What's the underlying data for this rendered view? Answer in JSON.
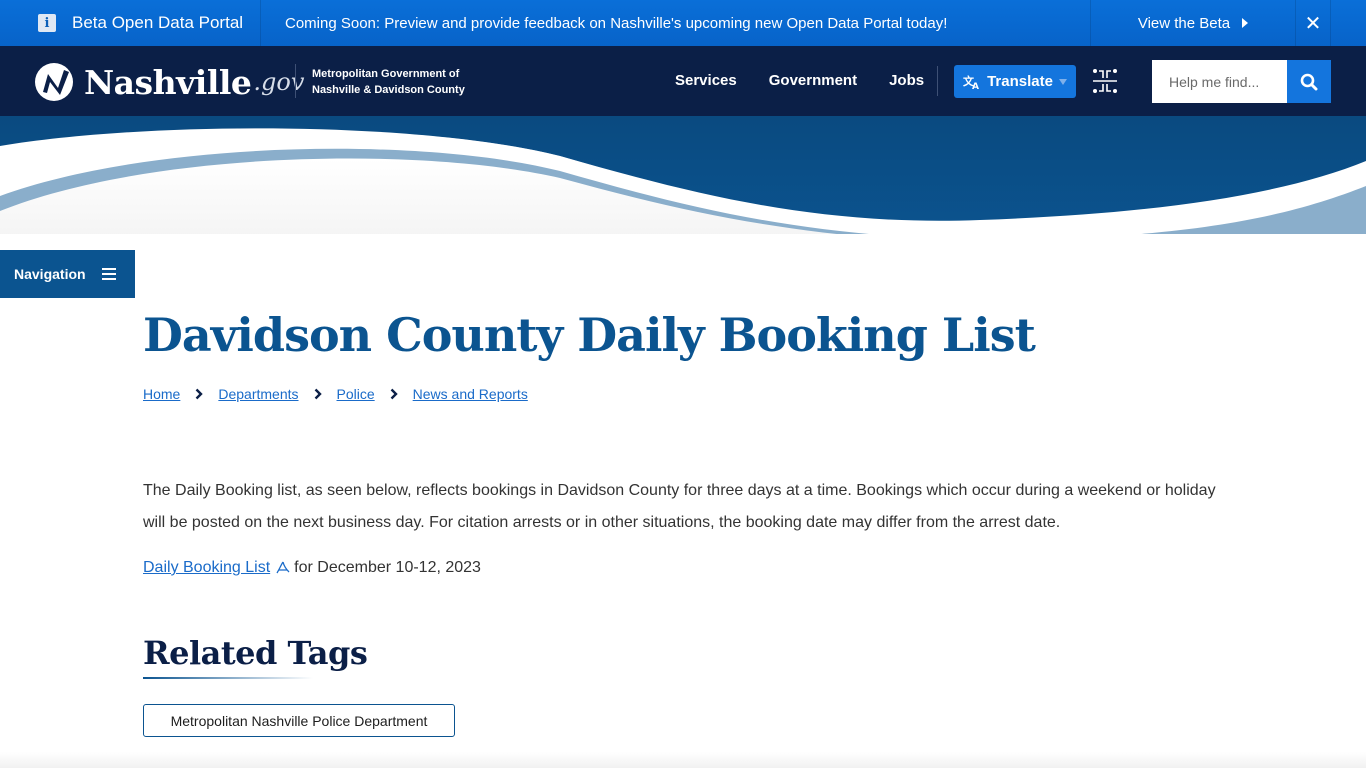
{
  "beta_banner": {
    "title": "Beta Open Data Portal",
    "message": "Coming Soon: Preview and provide feedback on Nashville's upcoming new Open Data Portal today!",
    "view_label": "View the Beta",
    "close_label": "✕",
    "info_icon": "i"
  },
  "header": {
    "logo_text": "Nashville",
    "logo_suffix": ".gov",
    "org_line1": "Metropolitan Government of",
    "org_line2": "Nashville & Davidson County",
    "nav": [
      "Services",
      "Government",
      "Jobs"
    ],
    "translate_label": "Translate",
    "search_placeholder": "Help me find..."
  },
  "sidebar": {
    "navigation_label": "Navigation"
  },
  "main": {
    "title": "Davidson County Daily Booking List",
    "breadcrumb": [
      "Home",
      "Departments",
      "Police",
      "News and Reports"
    ],
    "intro": "The Daily Booking list, as seen below, reflects bookings in Davidson County for three days at a time. Bookings which occur during a weekend or holiday will be posted on the next business day. For citation arrests or in other situations, the booking date may differ from the arrest date.",
    "download_link": "Daily Booking List",
    "download_suffix": "for December 10-12, 2023",
    "related_heading": "Related Tags",
    "tags": [
      "Metropolitan Nashville Police Department"
    ]
  },
  "colors": {
    "banner": "#0a6fd8",
    "header": "#0b1f47",
    "accent": "#1475dd",
    "primary": "#0b5490",
    "link": "#1a6bc9"
  }
}
